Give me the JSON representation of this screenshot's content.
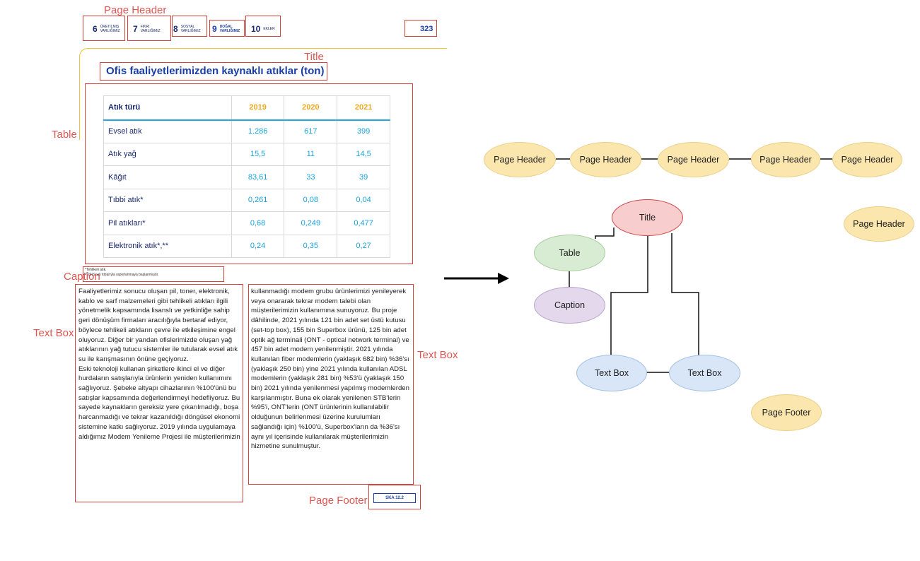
{
  "labels": {
    "page_header": "Page Header",
    "title": "Title",
    "table": "Table",
    "caption": "Caption",
    "text_box": "Text Box",
    "page_footer": "Page Footer"
  },
  "document": {
    "header": {
      "items": [
        {
          "num": "6",
          "text": "ÜRETILMIŞ VARLIĞIMIZ"
        },
        {
          "num": "7",
          "text": "FIKRI VARLIĞIMIZ"
        },
        {
          "num": "8",
          "text": "SOSYAL VARLIĞIMIZ"
        },
        {
          "num": "9",
          "text": "DOĞAL VARLIĞIMIZ"
        },
        {
          "num": "10",
          "text": "EKLER"
        }
      ],
      "page_number": "323"
    },
    "title": "Ofis faaliyetlerimizden kaynaklı atıklar (ton)",
    "table": {
      "headers": [
        "Atık türü",
        "2019",
        "2020",
        "2021"
      ],
      "rows": [
        [
          "Evsel atık",
          "1.286",
          "617",
          "399"
        ],
        [
          "Atık yağ",
          "15,5",
          "11",
          "14,5"
        ],
        [
          "Kâğıt",
          "83,61",
          "33",
          "39"
        ],
        [
          "Tıbbi atık*",
          "0,261",
          "0,08",
          "0,04"
        ],
        [
          "Pil atıkları*",
          "0,68",
          "0,249",
          "0,477"
        ],
        [
          "Elektronik atık*,**",
          "0,24",
          "0,35",
          "0,27"
        ]
      ]
    },
    "caption": {
      "line1": "*Tehlikeli atık.",
      "line2": "**2019 yılı itibarıyla raporlanmaya başlanmıştır."
    },
    "text_left": "Faaliyetlerimiz sonucu oluşan pil, toner, elektronik, kablo ve sarf malzemeleri gibi tehlikeli atıkları ilgili yönetmelik kapsamında lisanslı ve yetkinliğe sahip geri dönüşüm firmaları aracılığıyla bertaraf ediyor, böylece tehlikeli atıkların çevre ile etkileşimine engel oluyoruz. Diğer bir yandan ofislerimizde oluşan yağ atıklarının yağ tutucu sistemler ile tutularak evsel atık su ile karışmasının önüne geçiyoruz.\nEski teknoloji kullanan şirketlere ikinci el ve diğer hurdaların satışlarıyla ürünlerin yeniden kullanımını sağlıyoruz. Şebeke altyapı cihazlarının %100'ünü bu satışlar kapsamında değerlendirmeyi hedefliyoruz. Bu sayede kaynakların gereksiz yere çıkarılmadığı, boşa harcanmadığı ve tekrar kazanıldığı döngüsel ekonomi sistemine katkı sağlıyoruz. 2019 yılında uygulamaya aldığımız Modem Yenileme Projesi ile müşterilerimizin",
    "text_right": "kullanmadığı modem grubu ürünlerimizi yenileyerek veya onararak tekrar modem talebi olan müşterilerimizin kullanımına sunuyoruz. Bu proje dâhilinde, 2021 yılında 121 bin adet set üstü kutusu (set-top box), 155 bin Superbox ürünü, 125 bin adet optik ağ terminali (ONT - optical network terminal) ve 457 bin adet modem yenilenmiştir. 2021 yılında kullanılan fiber modemlerin (yaklaşık 682 bin) %36'sı (yaklaşık 250 bin) yine 2021 yılında kullanılan ADSL modemlerin (yaklaşık 281 bin) %53'ü (yaklaşık 150 bin) 2021 yılında yenilenmesi yapılmış modemlerden karşılanmıştır. Buna ek olarak yenilenen STB'lerin %95'i, ONT'lerin (ONT ürünlerinin kullanılabilir olduğunun belirlenmesi üzerine kurulumları sağlandığı için) %100'ü, Superbox'ların da %36'sı aynı yıl içerisinde kullanılarak müşterilerimizin hizmetine sunulmuştur.",
    "footer": "SKA 12.2"
  },
  "graph": {
    "nodes": {
      "header1": "Page Header",
      "header2": "Page Header",
      "header3": "Page Header",
      "header4": "Page Header",
      "header5": "Page Header",
      "header6": "Page Header",
      "title": "Title",
      "table": "Table",
      "caption": "Caption",
      "text1": "Text Box",
      "text2": "Text Box",
      "footer": "Page Footer"
    }
  },
  "colors": {
    "annotation_red": "#d9413b",
    "header_node": "#fbe6ad",
    "title_node": "#f8cdcd",
    "table_node": "#d8ecd3",
    "caption_node": "#e4d8ec",
    "textbox_node": "#d8e6f8"
  }
}
